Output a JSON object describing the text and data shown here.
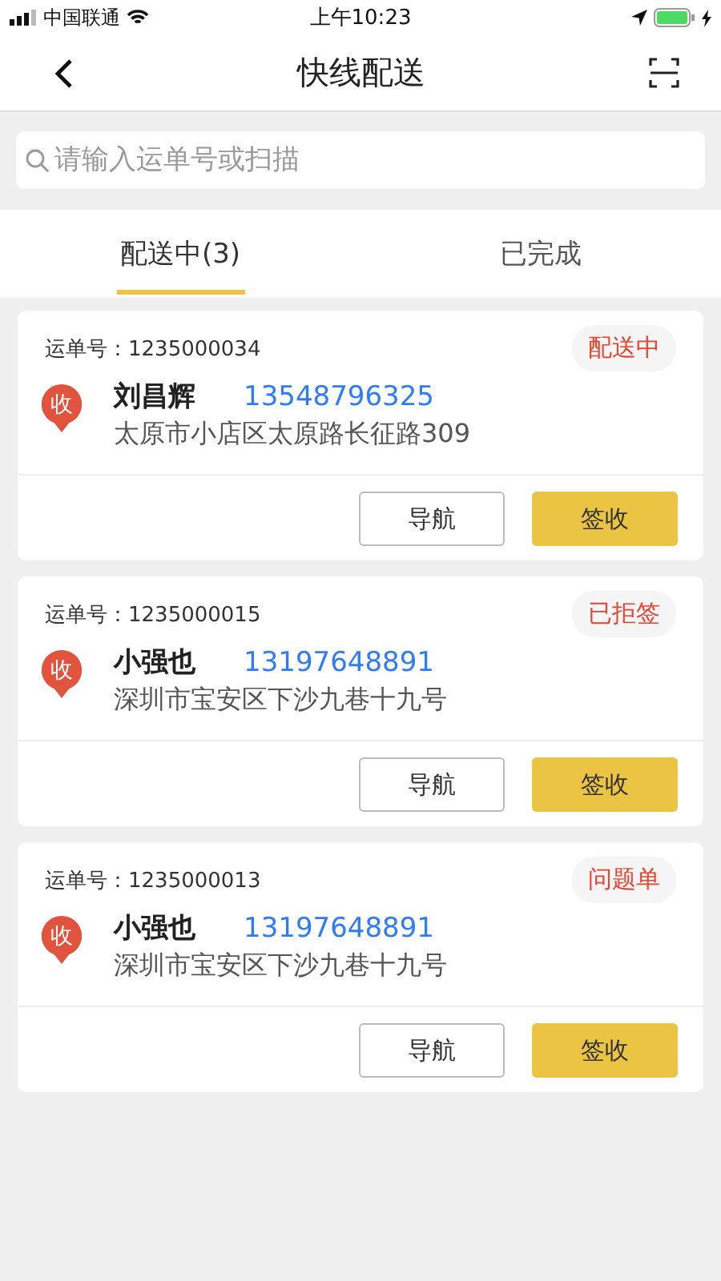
{
  "status_bar": {
    "carrier": "中国联通",
    "time": "上午10:23"
  },
  "header": {
    "title": "快线配送"
  },
  "search": {
    "placeholder": "请输入运单号或扫描"
  },
  "tabs": [
    {
      "label": "配送中(3)",
      "selected": true
    },
    {
      "label": "已完成",
      "selected": false
    }
  ],
  "orders": [
    {
      "waybill_label": "运单号：",
      "waybill": "1235000034",
      "status": "配送中",
      "pin_label": "收",
      "name": "刘昌辉",
      "phone": "13548796325",
      "address": "太原市小店区太原路长征路309",
      "buttons": [
        "导航",
        "签收"
      ]
    },
    {
      "waybill_label": "运单号：",
      "waybill": "1235000015",
      "status": "已拒签",
      "pin_label": "收",
      "name": "小强也",
      "phone": "13197648891",
      "address": "深圳市宝安区下沙九巷十九号",
      "buttons": [
        "导航",
        "签收"
      ]
    },
    {
      "waybill_label": "运单号：",
      "waybill": "1235000013",
      "status": "问题单",
      "pin_label": "收",
      "name": "小强也",
      "phone": "13197648891",
      "address": "深圳市宝安区下沙九巷十九号",
      "buttons": [
        "导航",
        "签收"
      ]
    }
  ]
}
